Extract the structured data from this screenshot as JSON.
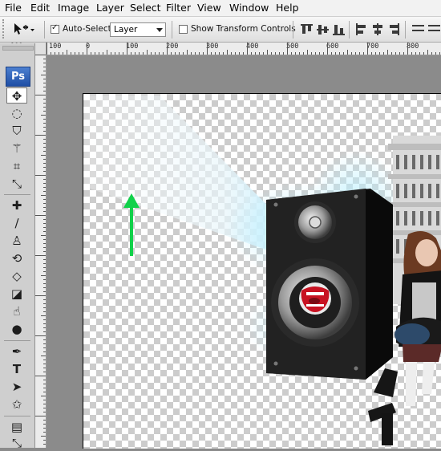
{
  "menu": [
    "File",
    "Edit",
    "Image",
    "Layer",
    "Select",
    "Filter",
    "View",
    "Window",
    "Help"
  ],
  "options": {
    "auto_select_label": "Auto-Select:",
    "auto_select_value": "Layer",
    "show_transform_label": "Show Transform Controls"
  },
  "ruler_h": [
    "100",
    "0",
    "100",
    "200",
    "300",
    "400",
    "500",
    "600",
    "700",
    "800"
  ],
  "toolbox": {
    "logo": "Ps"
  },
  "colors": {
    "arrow": "#11d14a",
    "ps_blue": "#2a5fb8"
  },
  "canvas": {
    "type_tool_glyph": "T"
  }
}
